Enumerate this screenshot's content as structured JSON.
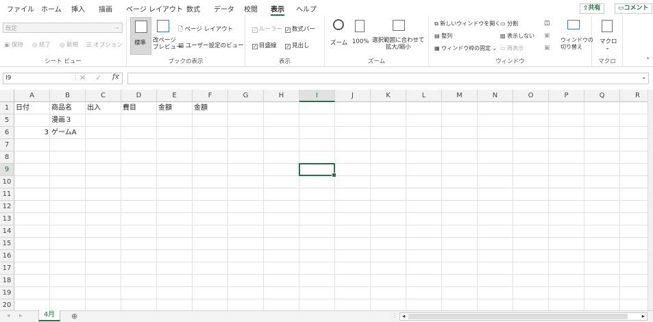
{
  "tabs": [
    "ファイル",
    "ホーム",
    "挿入",
    "描画",
    "ページ レイアウト",
    "数式",
    "データ",
    "校閲",
    "表示",
    "ヘルプ"
  ],
  "active_tab": "表示",
  "share_label": "共有",
  "comment_label": "コメント",
  "ribbon": {
    "sheetview": {
      "select_value": "既定",
      "keep": "保持",
      "exit": "終了",
      "new": "新規",
      "options": "オプション",
      "label": "シート ビュー"
    },
    "bookview": {
      "normal": "標準",
      "pagebreak": "改ページ\nプレビュー",
      "pagelayout": "ページ レイアウト",
      "custom": "ユーザー設定のビュー",
      "label": "ブックの表示"
    },
    "show": {
      "ruler": "ルーラー",
      "formulabar": "数式バー",
      "gridlines": "目盛線",
      "headings": "見出し",
      "label": "表示"
    },
    "zoom": {
      "zoom": "ズーム",
      "pct": "100%",
      "fit": "選択範囲に合わせて\n拡大/縮小",
      "label": "ズーム"
    },
    "window": {
      "newwin": "新しいウィンドウを開く",
      "arrange": "整列",
      "freeze": "ウィンドウ枠の固定",
      "split": "分割",
      "hide": "表示しない",
      "unhide": "再表示",
      "switch": "ウィンドウの\n切り替え",
      "label": "ウィンドウ"
    },
    "macro": {
      "macro": "マクロ",
      "label": "マクロ"
    }
  },
  "namebox": "I9",
  "fx": "fx",
  "columns": [
    "A",
    "B",
    "C",
    "D",
    "E",
    "F",
    "G",
    "H",
    "I",
    "J",
    "K",
    "L",
    "M",
    "N",
    "O",
    "P",
    "Q",
    "R"
  ],
  "selected_column": "I",
  "rows": [
    "1",
    "5",
    "6",
    "7",
    "8",
    "9",
    "10",
    "11",
    "12",
    "13",
    "14",
    "15",
    "16",
    "17",
    "18",
    "19",
    "20"
  ],
  "selected_row": "9",
  "cells": {
    "r1": [
      "日付",
      "商品名",
      "出入",
      "費目",
      "金額",
      "金額"
    ],
    "r5b": "漫画３",
    "r6a": "3",
    "r6b": "ゲームA"
  },
  "sheet_tab": "4月",
  "add_sheet": "⊕",
  "accent": "#217346"
}
